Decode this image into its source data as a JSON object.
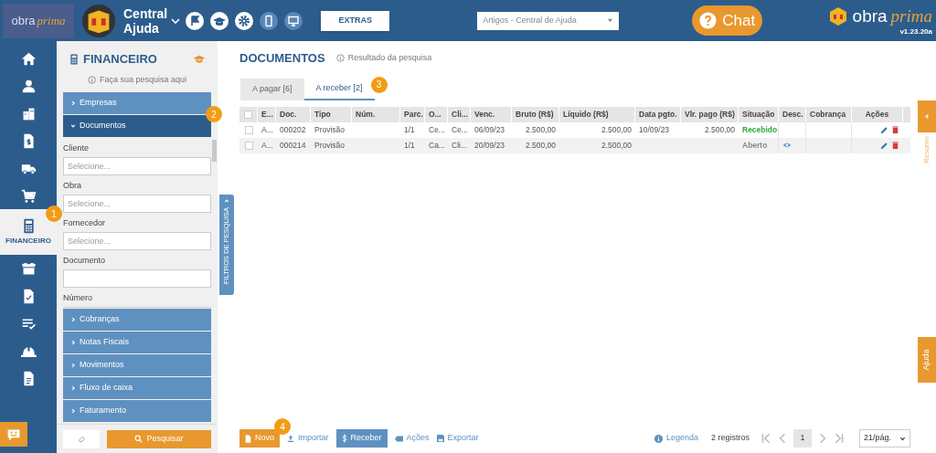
{
  "header": {
    "brand_left": {
      "word1": "obra",
      "word2": "prima"
    },
    "company": {
      "line1": "Central",
      "line2": "Ajuda"
    },
    "extras_button": "EXTRAS",
    "help_select": "Artigos - Central de Ajuda",
    "chat_button": "Chat",
    "brand_right": {
      "word1": "obra",
      "word2": "prima",
      "version": "v1.23.20a"
    }
  },
  "nav": [
    {
      "selected": false
    },
    {
      "selected": false
    },
    {
      "selected": false
    },
    {
      "selected": false
    },
    {
      "selected": false
    },
    {
      "selected": false
    },
    {
      "label": "FINANCEIRO",
      "selected": true,
      "badge": "1"
    },
    {
      "selected": false
    },
    {
      "selected": false
    },
    {
      "selected": false
    },
    {
      "selected": false
    },
    {
      "selected": false
    }
  ],
  "filters": {
    "title": "FINANCEIRO",
    "hint": "Faça sua pesquisa aqui",
    "side_tab": "FILTROS DE PESQUISA",
    "sections": [
      {
        "label": "Empresas",
        "expanded": false
      },
      {
        "label": "Documentos",
        "expanded": true,
        "badge": "2",
        "fields": [
          {
            "label": "Cliente",
            "placeholder": "Selecione..."
          },
          {
            "label": "Obra",
            "placeholder": "Selecione..."
          },
          {
            "label": "Fornecedor",
            "placeholder": "Selecione..."
          },
          {
            "label": "Documento"
          },
          {
            "label": "Número"
          }
        ]
      },
      {
        "label": "Cobranças",
        "expanded": false
      },
      {
        "label": "Notas Fiscais",
        "expanded": false
      },
      {
        "label": "Movimentos",
        "expanded": false
      },
      {
        "label": "Fluxo de caixa",
        "expanded": false
      },
      {
        "label": "Faturamento",
        "expanded": false
      }
    ],
    "search_button": "Pesquisar"
  },
  "main": {
    "title": "DOCUMENTOS",
    "hint": "Resultado da pesquisa",
    "tabs": [
      {
        "label": "A pagar [6]",
        "selected": false
      },
      {
        "label": "A receber [2]",
        "selected": true,
        "badge": "3"
      }
    ],
    "table": {
      "select_all_checked": false,
      "columns": [
        "E...",
        "Doc.",
        "Tipo",
        "Núm.",
        "Parc.",
        "O...",
        "Cli...",
        "Venc.",
        "Bruto (R$)",
        "Líquido (R$)",
        "Data pgto.",
        "Vlr. pago (R$)",
        "Situação",
        "Desc.",
        "Cobrança",
        "Ações"
      ],
      "rows": [
        {
          "checked": false,
          "cells": [
            "A...",
            "000202",
            "Provisão",
            "",
            "1/1",
            "Ce...",
            "Ce...",
            "06/09/23",
            "2.500,00",
            "2.500,00",
            "10/09/23",
            "2.500,00"
          ],
          "status": {
            "text": "Recebido",
            "kind": "paid"
          },
          "has_description": false
        },
        {
          "checked": false,
          "cells": [
            "A...",
            "000214",
            "Provisão",
            "",
            "1/1",
            "Ca...",
            "Cli...",
            "20/09/23",
            "2.500,00",
            "2.500,00",
            "",
            ""
          ],
          "status": {
            "text": "Aberto",
            "kind": "open"
          },
          "has_description": true
        }
      ]
    }
  },
  "side_tabs": {
    "summary": "Resumo",
    "help": "Ajuda"
  },
  "footer": {
    "new_button": "Novo",
    "new_badge": "4",
    "import": "Importar",
    "receive_button": "Receber",
    "actions": "Ações",
    "export": "Exportar",
    "legend": "Legenda",
    "count": "2 registros",
    "page": "1",
    "page_size": "21/pág."
  }
}
